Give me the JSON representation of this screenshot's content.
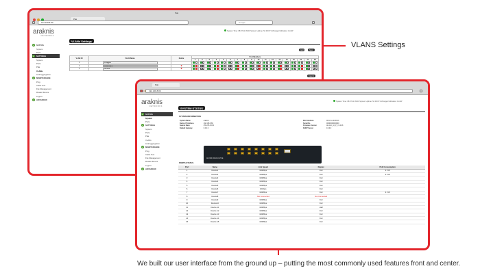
{
  "vlan_window": {
    "tab_title": "Pak",
    "window_title": "Pak",
    "url": "192.168.8.80",
    "search_placeholder": "Google",
    "logo": "araknis",
    "logo_sub": "NETWORKS",
    "status_text": "System Time: 08:07:11 09:00  System Uptime: 5d 00:07:11  Budget Utilization: 11.0W",
    "sidebar": [
      {
        "group": "STATUS",
        "items": [
          "System",
          "Ports"
        ]
      },
      {
        "group": "SETTINGS",
        "selected": true,
        "items": [
          "System",
          "Ports",
          "PoE",
          "VLANs",
          "Link Aggregation"
        ]
      },
      {
        "group": "MAINTENANCE",
        "items": [
          "Ping",
          "Cable Test",
          "File Management",
          "Restart Device",
          "Logout"
        ]
      },
      {
        "group": "ADVANCED",
        "items": []
      }
    ],
    "page_title": "VLANs Settings",
    "buttons": [
      "Add",
      "Save",
      "Cancel"
    ],
    "table_headers": {
      "vlan_id": "VLAN ID",
      "vlan_name": "VLAN Name",
      "delete": "Delete",
      "port_members": "Port Members"
    },
    "port_numbers": [
      "1",
      "2",
      "3",
      "4",
      "5",
      "6",
      "7",
      "8",
      "9",
      "10",
      "11",
      "12",
      "13",
      "14",
      "15",
      "16",
      "17",
      "18"
    ],
    "rows": [
      {
        "id": "1",
        "name": "Untagged",
        "del": false
      },
      {
        "id": "2",
        "name": "Tonal Island",
        "del": true
      },
      {
        "id": "3",
        "name": "Camera",
        "del": true
      }
    ]
  },
  "status_window": {
    "tab_title": "Pak",
    "url": "192.168.8.80",
    "logo": "araknis",
    "logo_sub": "NETWORKS",
    "status_text": "System Time: 08:07:11 09:00  System Uptime: 5d 00:07:11  Budget Utilization: 11.0W",
    "sidebar": [
      {
        "group": "STATUS",
        "selected": true,
        "items": [
          "System",
          "Ports"
        ]
      },
      {
        "group": "SETTINGS",
        "items": [
          "System",
          "Ports",
          "PoE",
          "VLANs",
          "Link Aggregation"
        ]
      },
      {
        "group": "MAINTENANCE",
        "items": [
          "Ping",
          "Cable Test",
          "File Management",
          "Restart Device",
          "Logout"
        ]
      },
      {
        "group": "ADVANCED",
        "items": []
      }
    ],
    "page_title": "SYSTEM STATUS",
    "section_system": "SYSTEM INFORMATION",
    "system_info_left": [
      [
        "System Name",
        "araknis"
      ],
      [
        "Device IP Address",
        "192.168.8.80"
      ],
      [
        "Subnet Mask",
        "255.255.255.0"
      ],
      [
        "Default Gateway",
        "0.0.0.0"
      ]
    ],
    "system_info_right": [
      [
        "MAC Address",
        "00:1f:cc:a6:00:23"
      ],
      [
        "Serial No",
        "00000000000000"
      ],
      [
        "Firmware Version",
        "AN-110_16_P_V1.0.08"
      ],
      [
        "DHCP Server",
        "0.0.0.0"
      ]
    ],
    "switch_label": "AN-300-SW-R-16-POE",
    "section_ports": "PORTS STATUS",
    "port_headers": [
      "Port",
      "Name",
      "Link Speed",
      "Duplex",
      "PoE Consumption"
    ],
    "ports": [
      [
        "1",
        "Device1",
        "100Mbps",
        "Full",
        "3.5 W"
      ],
      [
        "2",
        "Device2",
        "100Mbps",
        "Full",
        "3.5 W"
      ],
      [
        "3",
        "Device3",
        "100Mbps",
        "Full",
        ""
      ],
      [
        "4",
        "Device4",
        "100Mbps",
        "Full",
        ""
      ],
      [
        "5",
        "Device5",
        "100Mbps",
        "Full",
        ""
      ],
      [
        "6",
        "Device6",
        "10Gbps",
        "Full",
        ""
      ],
      [
        "7",
        "Device7",
        "100Mbps",
        "Full",
        "3.5 W"
      ],
      [
        "8",
        "Device8",
        "Not Connected",
        "Not Connected",
        ""
      ],
      [
        "9",
        "Device9",
        "100Mbps",
        "Full",
        ""
      ],
      [
        "10",
        "Device10",
        "100Mbps",
        "Full",
        ""
      ],
      [
        "11",
        "Device 11",
        "100Mbps",
        "Half",
        ""
      ],
      [
        "12",
        "Device 12",
        "100Mbps",
        "Full",
        ""
      ],
      [
        "13",
        "Device 13",
        "100Mbps",
        "Full",
        ""
      ],
      [
        "14",
        "Device 14",
        "100Mbps",
        "Full",
        ""
      ],
      [
        "15",
        "Device 15",
        "100Mbps",
        "Full",
        ""
      ]
    ]
  },
  "callout": "VLANS Settings",
  "caption": "We built our user interface from the ground up – putting the most commonly used features front and center.",
  "colors": {
    "accent": "#e3262c",
    "ok_green": "#4c9c2e",
    "check_green": "#2e9e3b",
    "check_red": "#d43030"
  }
}
